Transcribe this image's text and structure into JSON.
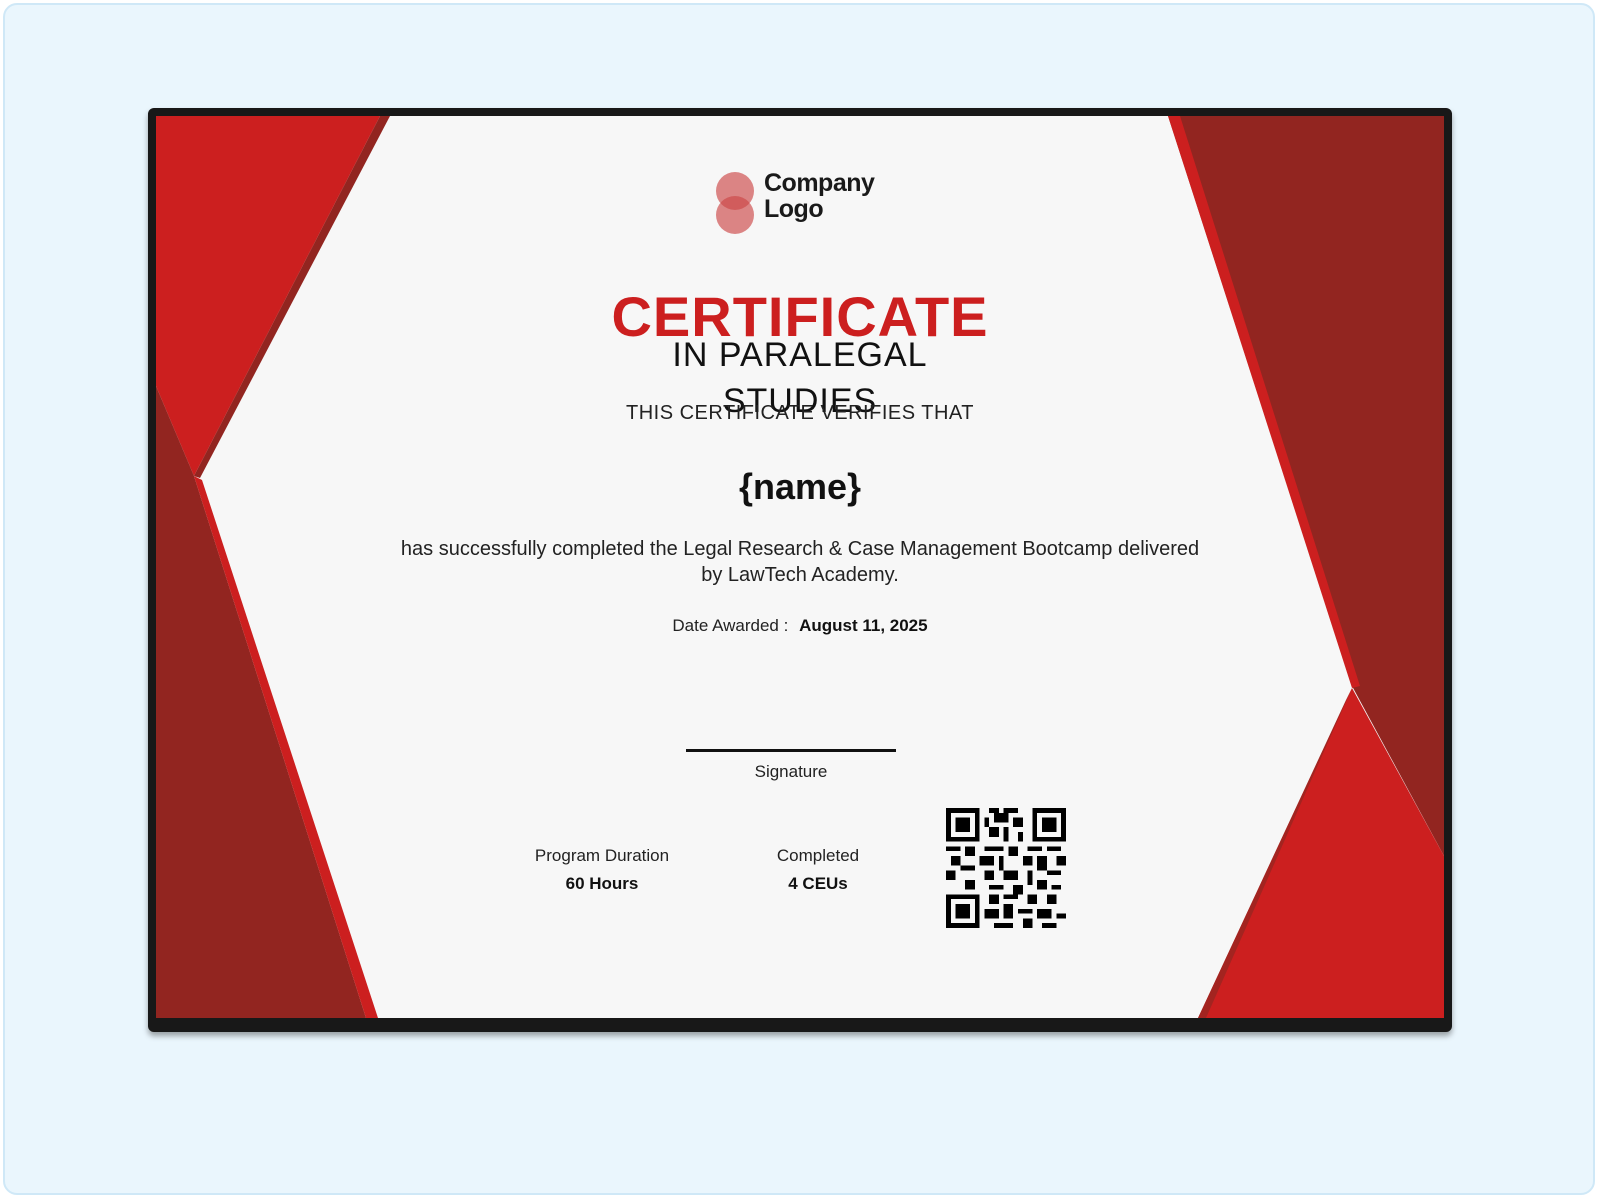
{
  "certificate": {
    "logo_text": "Company Logo",
    "title": "CERTIFICATE",
    "subtitle_line1": "IN PARALEGAL",
    "subtitle_line2": "STUDIES",
    "verifies_text": "THIS CERTIFICATE VERIFIES THAT",
    "recipient_name": "{name}",
    "description": "has successfully completed the Legal Research & Case Management Bootcamp delivered by LawTech Academy.",
    "date_label": "Date Awarded :",
    "date_value": "August 11, 2025",
    "signature_label": "Signature",
    "stats": [
      {
        "label": "Program Duration",
        "value": "60 Hours"
      },
      {
        "label": "Completed",
        "value": "4 CEUs"
      }
    ],
    "qr_code_icon": "qr-code-icon"
  },
  "colors": {
    "page_background": "#eaf6fd",
    "frame": "#181818",
    "paper": "#f7f7f7",
    "accent_red": "#cc1f1f",
    "dark_red": "#922520"
  }
}
